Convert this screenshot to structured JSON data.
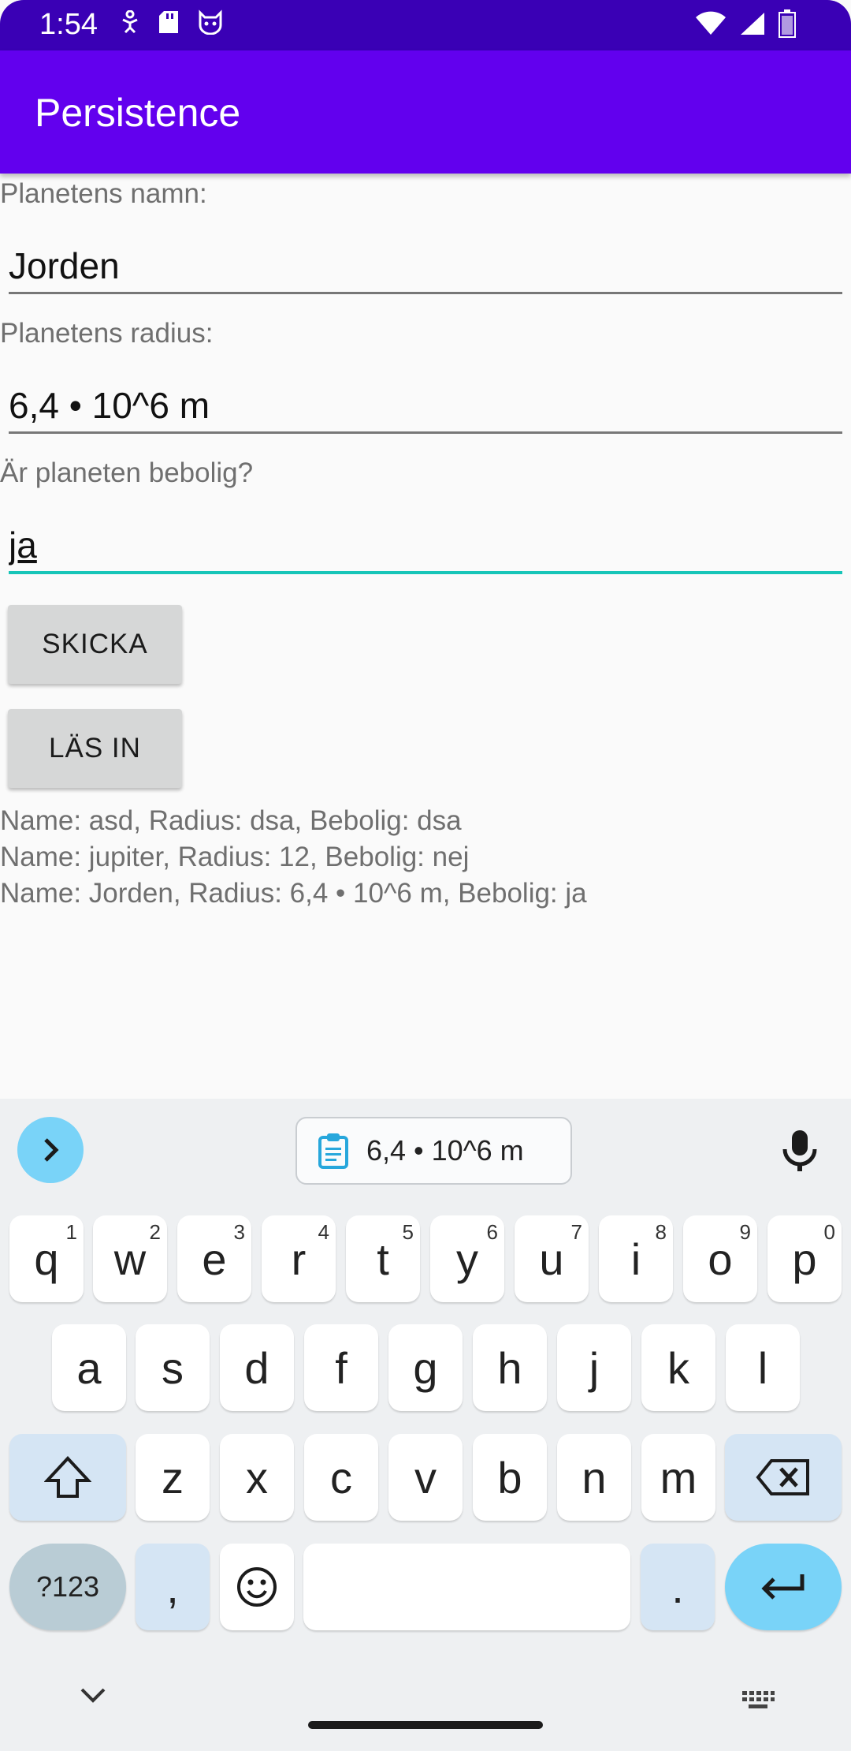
{
  "statusbar": {
    "time": "1:54",
    "icons_left": [
      "accessibility-icon",
      "sd-card-icon",
      "cat-icon"
    ],
    "icons_right": [
      "wifi-icon",
      "signal-icon",
      "battery-icon"
    ]
  },
  "appbar": {
    "title": "Persistence"
  },
  "form": {
    "name_label": "Planetens namn:",
    "name_value": "Jorden",
    "radius_label": "Planetens radius:",
    "radius_value": "6,4 • 10^6 m",
    "habitable_label": "Är planeten bebolig?",
    "habitable_value": "ja",
    "send_button": "SKICKA",
    "load_button": "LÄS IN"
  },
  "output": {
    "lines": [
      "Name: asd, Radius: dsa, Bebolig: dsa",
      "Name: jupiter, Radius: 12, Bebolig: nej",
      "Name: Jorden, Radius: 6,4 • 10^6 m, Bebolig: ja"
    ]
  },
  "keyboard": {
    "clipboard_text": "6,4 • 10^6 m",
    "row1": [
      {
        "k": "q",
        "h": "1"
      },
      {
        "k": "w",
        "h": "2"
      },
      {
        "k": "e",
        "h": "3"
      },
      {
        "k": "r",
        "h": "4"
      },
      {
        "k": "t",
        "h": "5"
      },
      {
        "k": "y",
        "h": "6"
      },
      {
        "k": "u",
        "h": "7"
      },
      {
        "k": "i",
        "h": "8"
      },
      {
        "k": "o",
        "h": "9"
      },
      {
        "k": "p",
        "h": "0"
      }
    ],
    "row2": [
      "a",
      "s",
      "d",
      "f",
      "g",
      "h",
      "j",
      "k",
      "l"
    ],
    "row3": [
      "z",
      "x",
      "c",
      "v",
      "b",
      "n",
      "m"
    ],
    "symbols_key": "?123",
    "comma_key": ",",
    "period_key": "."
  },
  "colors": {
    "status_bar": "#3a00b5",
    "app_bar": "#6200ee",
    "accent": "#17c5b8",
    "keyboard_accent": "#79d3f8"
  }
}
